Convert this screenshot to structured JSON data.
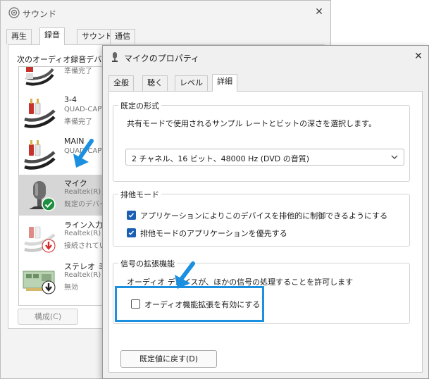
{
  "sound_window": {
    "title": "サウンド",
    "tabs": [
      "再生",
      "録音",
      "サウンド",
      "通信"
    ],
    "active_tab": "録音",
    "instruction": "次のオーディオ録音デバイスがインストールされています:",
    "devices": [
      {
        "name": "",
        "driver": "",
        "status": "準備完了",
        "icon": "rca-cable-icon"
      },
      {
        "name": "3-4",
        "driver": "QUAD-CAPTURE",
        "status": "準備完了",
        "icon": "rca-cable-icon"
      },
      {
        "name": "MAIN",
        "driver": "QUAD-CAPTURE",
        "status": "",
        "icon": "rca-cable-icon"
      },
      {
        "name": "マイク",
        "driver": "Realtek(R) Audio",
        "status": "既定のデバイス",
        "icon": "microphone-icon",
        "selected": true,
        "badge": "default-check-icon"
      },
      {
        "name": "ライン入力",
        "driver": "Realtek(R) Audio",
        "status": "接続されていません",
        "icon": "rca-cable-icon",
        "badge": "unplugged-icon"
      },
      {
        "name": "ステレオ ミキサー",
        "driver": "Realtek(R) Audio",
        "status": "無効",
        "icon": "sound-card-icon",
        "badge": "disabled-icon"
      }
    ],
    "configure_label": "構成(C)"
  },
  "props_window": {
    "title": "マイクのプロパティ",
    "tabs": [
      "全般",
      "聴く",
      "レベル",
      "詳細"
    ],
    "active_tab": "詳細",
    "default_format": {
      "title": "既定の形式",
      "description": "共有モードで使用されるサンプル レートとビットの深さを選択します。",
      "selected": "2 チャネル、16 ビット、48000 Hz (DVD の音質)"
    },
    "exclusive_mode": {
      "title": "排他モード",
      "options": [
        {
          "label": "アプリケーションによりこのデバイスを排他的に制御できるようにする",
          "checked": true
        },
        {
          "label": "排他モードのアプリケーションを優先する",
          "checked": true
        }
      ]
    },
    "enhancements": {
      "title": "信号の拡張機能",
      "description": "オーディオ デバイスが、ほかの信号の処理することを許可します",
      "option": {
        "label": "オーディオ機能拡張を有効にする",
        "checked": false
      }
    },
    "restore_defaults_label": "既定値に戻す(D)"
  },
  "colors": {
    "accent": "#1a5fb4",
    "callout_arrow": "#1b8fe0",
    "highlight_box": "#1b8fe0",
    "default_badge": "#1e8f3e",
    "unplugged_badge": "#d62a2a"
  }
}
